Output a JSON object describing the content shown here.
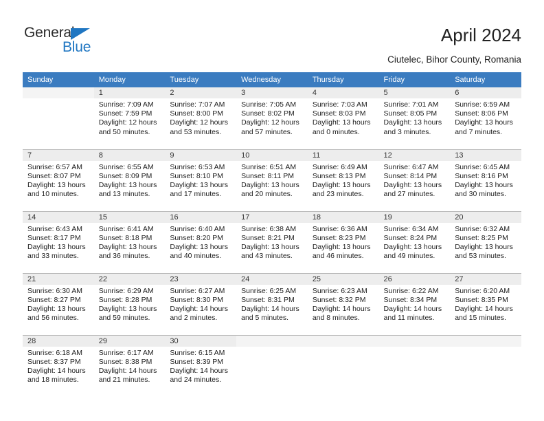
{
  "brand": {
    "name_top": "General",
    "name_bottom": "Blue",
    "accent_color": "#1f76c2"
  },
  "header": {
    "title": "April 2024",
    "subtitle": "Ciutelec, Bihor County, Romania",
    "header_bg": "#3b7cc0",
    "daynum_bg": "#ededed"
  },
  "weekdays": [
    "Sunday",
    "Monday",
    "Tuesday",
    "Wednesday",
    "Thursday",
    "Friday",
    "Saturday"
  ],
  "weeks": [
    [
      {
        "day": ""
      },
      {
        "day": "1",
        "sunrise": "Sunrise: 7:09 AM",
        "sunset": "Sunset: 7:59 PM",
        "daylight1": "Daylight: 12 hours",
        "daylight2": "and 50 minutes."
      },
      {
        "day": "2",
        "sunrise": "Sunrise: 7:07 AM",
        "sunset": "Sunset: 8:00 PM",
        "daylight1": "Daylight: 12 hours",
        "daylight2": "and 53 minutes."
      },
      {
        "day": "3",
        "sunrise": "Sunrise: 7:05 AM",
        "sunset": "Sunset: 8:02 PM",
        "daylight1": "Daylight: 12 hours",
        "daylight2": "and 57 minutes."
      },
      {
        "day": "4",
        "sunrise": "Sunrise: 7:03 AM",
        "sunset": "Sunset: 8:03 PM",
        "daylight1": "Daylight: 13 hours",
        "daylight2": "and 0 minutes."
      },
      {
        "day": "5",
        "sunrise": "Sunrise: 7:01 AM",
        "sunset": "Sunset: 8:05 PM",
        "daylight1": "Daylight: 13 hours",
        "daylight2": "and 3 minutes."
      },
      {
        "day": "6",
        "sunrise": "Sunrise: 6:59 AM",
        "sunset": "Sunset: 8:06 PM",
        "daylight1": "Daylight: 13 hours",
        "daylight2": "and 7 minutes."
      }
    ],
    [
      {
        "day": "7",
        "sunrise": "Sunrise: 6:57 AM",
        "sunset": "Sunset: 8:07 PM",
        "daylight1": "Daylight: 13 hours",
        "daylight2": "and 10 minutes."
      },
      {
        "day": "8",
        "sunrise": "Sunrise: 6:55 AM",
        "sunset": "Sunset: 8:09 PM",
        "daylight1": "Daylight: 13 hours",
        "daylight2": "and 13 minutes."
      },
      {
        "day": "9",
        "sunrise": "Sunrise: 6:53 AM",
        "sunset": "Sunset: 8:10 PM",
        "daylight1": "Daylight: 13 hours",
        "daylight2": "and 17 minutes."
      },
      {
        "day": "10",
        "sunrise": "Sunrise: 6:51 AM",
        "sunset": "Sunset: 8:11 PM",
        "daylight1": "Daylight: 13 hours",
        "daylight2": "and 20 minutes."
      },
      {
        "day": "11",
        "sunrise": "Sunrise: 6:49 AM",
        "sunset": "Sunset: 8:13 PM",
        "daylight1": "Daylight: 13 hours",
        "daylight2": "and 23 minutes."
      },
      {
        "day": "12",
        "sunrise": "Sunrise: 6:47 AM",
        "sunset": "Sunset: 8:14 PM",
        "daylight1": "Daylight: 13 hours",
        "daylight2": "and 27 minutes."
      },
      {
        "day": "13",
        "sunrise": "Sunrise: 6:45 AM",
        "sunset": "Sunset: 8:16 PM",
        "daylight1": "Daylight: 13 hours",
        "daylight2": "and 30 minutes."
      }
    ],
    [
      {
        "day": "14",
        "sunrise": "Sunrise: 6:43 AM",
        "sunset": "Sunset: 8:17 PM",
        "daylight1": "Daylight: 13 hours",
        "daylight2": "and 33 minutes."
      },
      {
        "day": "15",
        "sunrise": "Sunrise: 6:41 AM",
        "sunset": "Sunset: 8:18 PM",
        "daylight1": "Daylight: 13 hours",
        "daylight2": "and 36 minutes."
      },
      {
        "day": "16",
        "sunrise": "Sunrise: 6:40 AM",
        "sunset": "Sunset: 8:20 PM",
        "daylight1": "Daylight: 13 hours",
        "daylight2": "and 40 minutes."
      },
      {
        "day": "17",
        "sunrise": "Sunrise: 6:38 AM",
        "sunset": "Sunset: 8:21 PM",
        "daylight1": "Daylight: 13 hours",
        "daylight2": "and 43 minutes."
      },
      {
        "day": "18",
        "sunrise": "Sunrise: 6:36 AM",
        "sunset": "Sunset: 8:23 PM",
        "daylight1": "Daylight: 13 hours",
        "daylight2": "and 46 minutes."
      },
      {
        "day": "19",
        "sunrise": "Sunrise: 6:34 AM",
        "sunset": "Sunset: 8:24 PM",
        "daylight1": "Daylight: 13 hours",
        "daylight2": "and 49 minutes."
      },
      {
        "day": "20",
        "sunrise": "Sunrise: 6:32 AM",
        "sunset": "Sunset: 8:25 PM",
        "daylight1": "Daylight: 13 hours",
        "daylight2": "and 53 minutes."
      }
    ],
    [
      {
        "day": "21",
        "sunrise": "Sunrise: 6:30 AM",
        "sunset": "Sunset: 8:27 PM",
        "daylight1": "Daylight: 13 hours",
        "daylight2": "and 56 minutes."
      },
      {
        "day": "22",
        "sunrise": "Sunrise: 6:29 AM",
        "sunset": "Sunset: 8:28 PM",
        "daylight1": "Daylight: 13 hours",
        "daylight2": "and 59 minutes."
      },
      {
        "day": "23",
        "sunrise": "Sunrise: 6:27 AM",
        "sunset": "Sunset: 8:30 PM",
        "daylight1": "Daylight: 14 hours",
        "daylight2": "and 2 minutes."
      },
      {
        "day": "24",
        "sunrise": "Sunrise: 6:25 AM",
        "sunset": "Sunset: 8:31 PM",
        "daylight1": "Daylight: 14 hours",
        "daylight2": "and 5 minutes."
      },
      {
        "day": "25",
        "sunrise": "Sunrise: 6:23 AM",
        "sunset": "Sunset: 8:32 PM",
        "daylight1": "Daylight: 14 hours",
        "daylight2": "and 8 minutes."
      },
      {
        "day": "26",
        "sunrise": "Sunrise: 6:22 AM",
        "sunset": "Sunset: 8:34 PM",
        "daylight1": "Daylight: 14 hours",
        "daylight2": "and 11 minutes."
      },
      {
        "day": "27",
        "sunrise": "Sunrise: 6:20 AM",
        "sunset": "Sunset: 8:35 PM",
        "daylight1": "Daylight: 14 hours",
        "daylight2": "and 15 minutes."
      }
    ],
    [
      {
        "day": "28",
        "sunrise": "Sunrise: 6:18 AM",
        "sunset": "Sunset: 8:37 PM",
        "daylight1": "Daylight: 14 hours",
        "daylight2": "and 18 minutes."
      },
      {
        "day": "29",
        "sunrise": "Sunrise: 6:17 AM",
        "sunset": "Sunset: 8:38 PM",
        "daylight1": "Daylight: 14 hours",
        "daylight2": "and 21 minutes."
      },
      {
        "day": "30",
        "sunrise": "Sunrise: 6:15 AM",
        "sunset": "Sunset: 8:39 PM",
        "daylight1": "Daylight: 14 hours",
        "daylight2": "and 24 minutes."
      },
      {
        "day": ""
      },
      {
        "day": ""
      },
      {
        "day": ""
      },
      {
        "day": ""
      }
    ]
  ]
}
